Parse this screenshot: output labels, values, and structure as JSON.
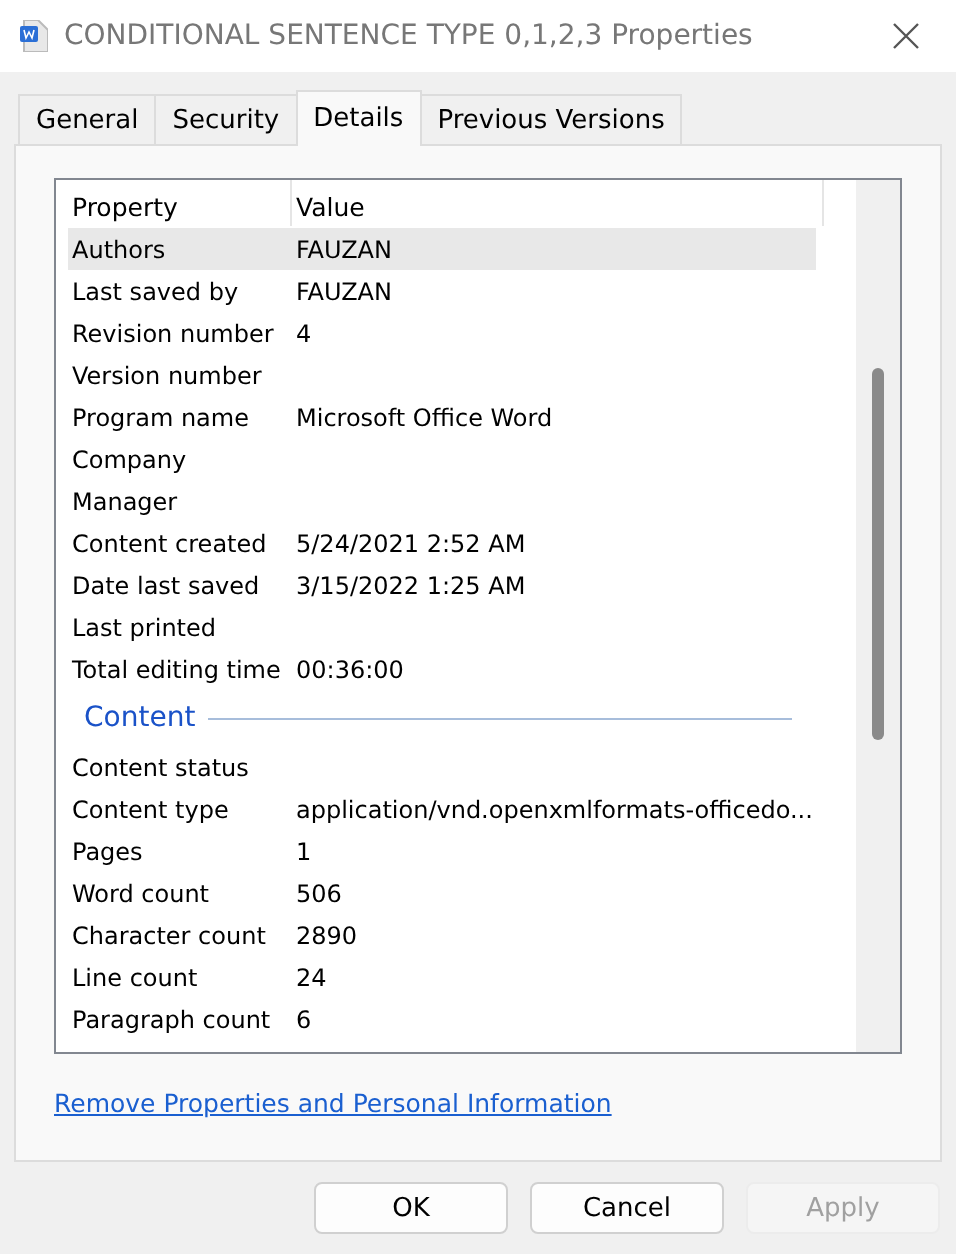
{
  "window": {
    "title": "CONDITIONAL SENTENCE TYPE 0,1,2,3 Properties"
  },
  "tabs": [
    {
      "label": "General",
      "selected": false
    },
    {
      "label": "Security",
      "selected": false
    },
    {
      "label": "Details",
      "selected": true
    },
    {
      "label": "Previous Versions",
      "selected": false
    }
  ],
  "table": {
    "columns": [
      "Property",
      "Value"
    ],
    "sections": [
      {
        "rows": [
          {
            "property": "Authors",
            "value": "FAUZAN",
            "selected": true
          },
          {
            "property": "Last saved by",
            "value": "FAUZAN",
            "selected": false
          },
          {
            "property": "Revision number",
            "value": "4",
            "selected": false
          },
          {
            "property": "Version number",
            "value": "",
            "selected": false
          },
          {
            "property": "Program name",
            "value": "Microsoft Office Word",
            "selected": false
          },
          {
            "property": "Company",
            "value": "",
            "selected": false
          },
          {
            "property": "Manager",
            "value": "",
            "selected": false
          },
          {
            "property": "Content created",
            "value": "5/24/2021 2:52 AM",
            "selected": false
          },
          {
            "property": "Date last saved",
            "value": "3/15/2022 1:25 AM",
            "selected": false
          },
          {
            "property": "Last printed",
            "value": "",
            "selected": false
          },
          {
            "property": "Total editing time",
            "value": "00:36:00",
            "selected": false
          }
        ]
      },
      {
        "heading": "Content",
        "rows": [
          {
            "property": "Content status",
            "value": "",
            "selected": false
          },
          {
            "property": "Content type",
            "value": "application/vnd.openxmlformats-officedo...",
            "selected": false
          },
          {
            "property": "Pages",
            "value": "1",
            "selected": false
          },
          {
            "property": "Word count",
            "value": "506",
            "selected": false
          },
          {
            "property": "Character count",
            "value": "2890",
            "selected": false
          },
          {
            "property": "Line count",
            "value": "24",
            "selected": false
          },
          {
            "property": "Paragraph count",
            "value": "6",
            "selected": false
          }
        ]
      }
    ]
  },
  "link": "Remove Properties and Personal Information",
  "buttons": [
    {
      "label": "OK",
      "disabled": false
    },
    {
      "label": "Cancel",
      "disabled": false
    },
    {
      "label": "Apply",
      "disabled": true
    }
  ]
}
